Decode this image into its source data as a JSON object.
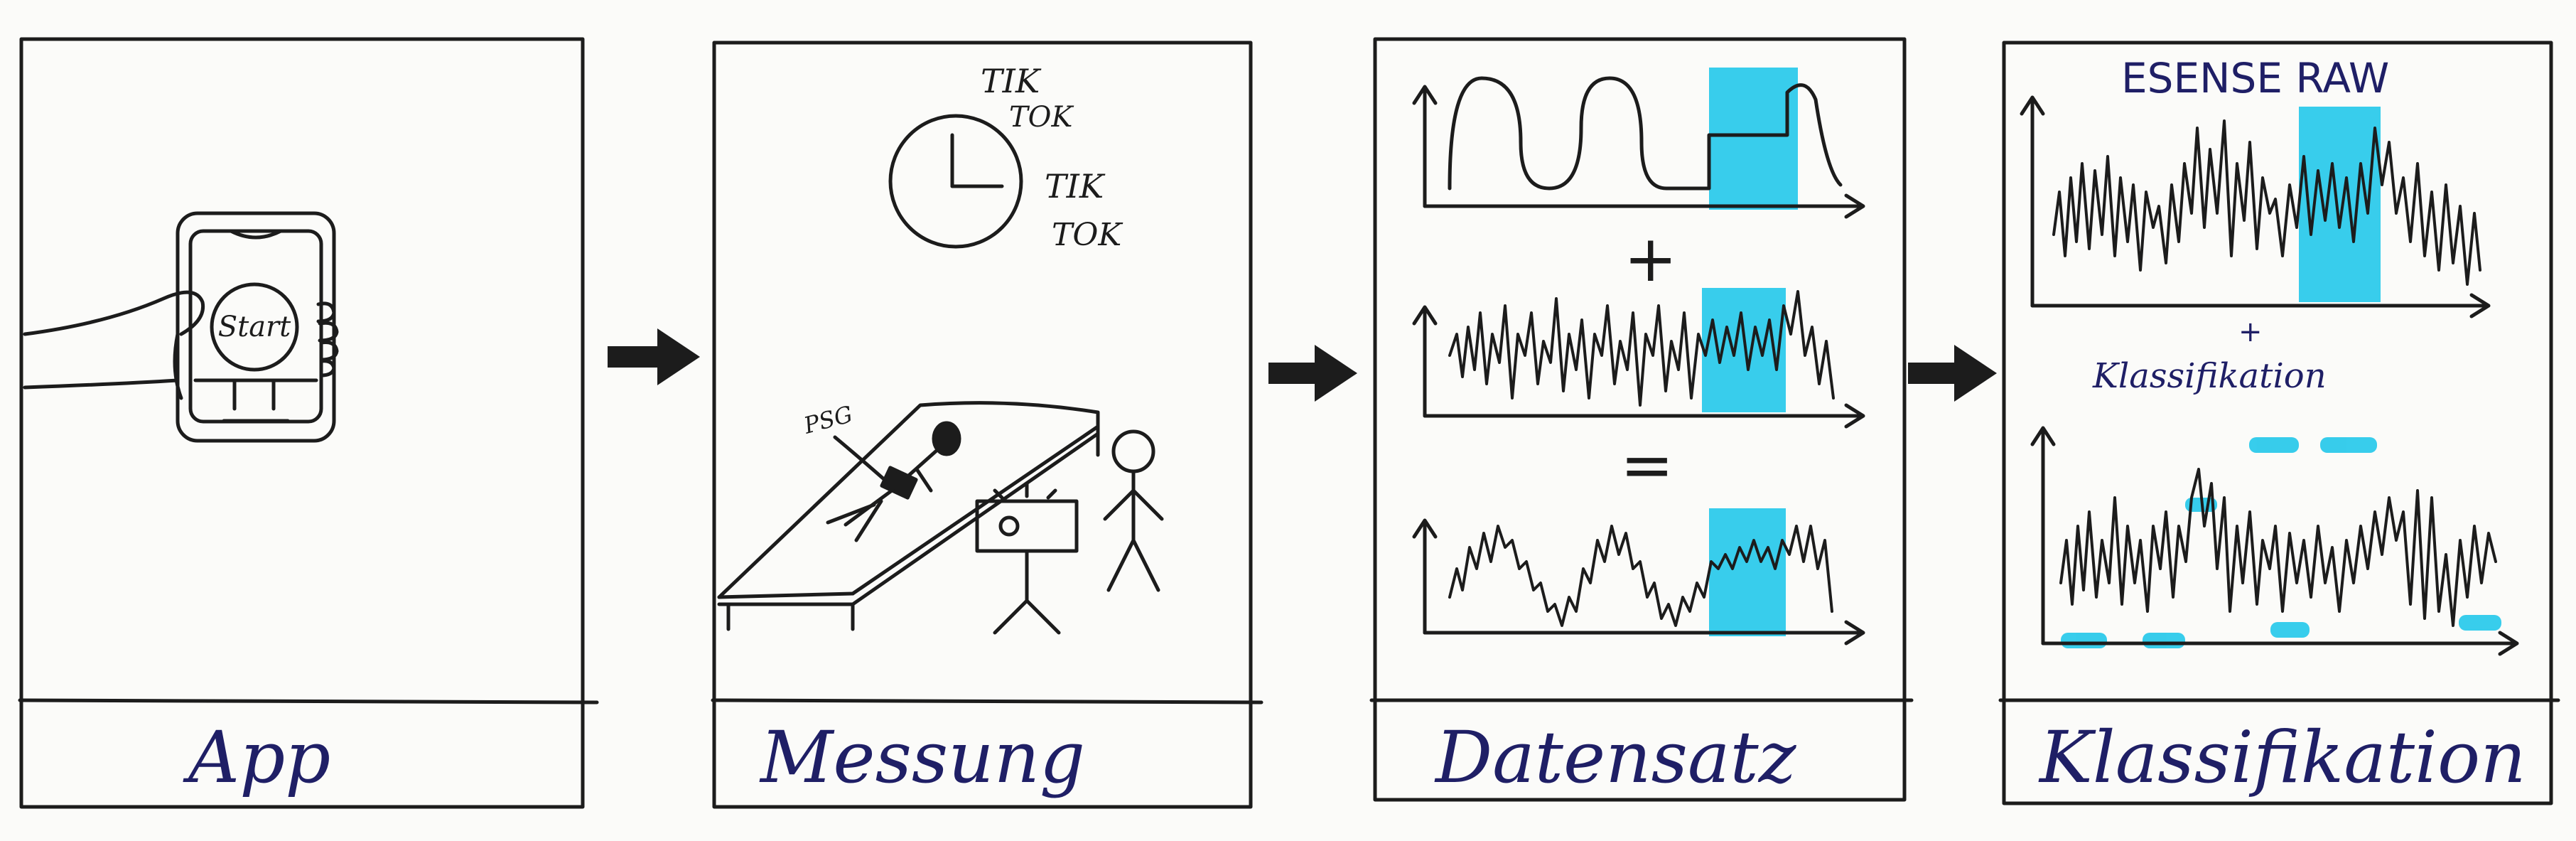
{
  "colors": {
    "ink": "#1c1c1c",
    "label_ink": "#1f1f66",
    "highlight": "#22c8ea",
    "paper": "#fbfbf9"
  },
  "panels": [
    {
      "id": "app",
      "label": "App"
    },
    {
      "id": "messung",
      "label": "Messung"
    },
    {
      "id": "datensatz",
      "label": "Datensatz"
    },
    {
      "id": "klassifikation",
      "label": "Klassifikation"
    }
  ],
  "app_panel": {
    "start_button": "Start"
  },
  "messung_panel": {
    "clock_text_1a": "TIK",
    "clock_text_1b": "TOK",
    "clock_text_2a": "TIK",
    "clock_text_2b": "TOK",
    "psg_label": "PSG"
  },
  "datensatz_panel": {
    "plus_sign": "+",
    "equals_sign": "="
  },
  "klassifikation_panel": {
    "title": "ESENSE RAW",
    "plus_sign": "+",
    "subtitle": "Klassifikation"
  },
  "icons": [
    "arrow-right-icon",
    "clock-icon",
    "phone-icon",
    "hand-icon",
    "bed-icon",
    "person-icon",
    "camera-icon"
  ]
}
